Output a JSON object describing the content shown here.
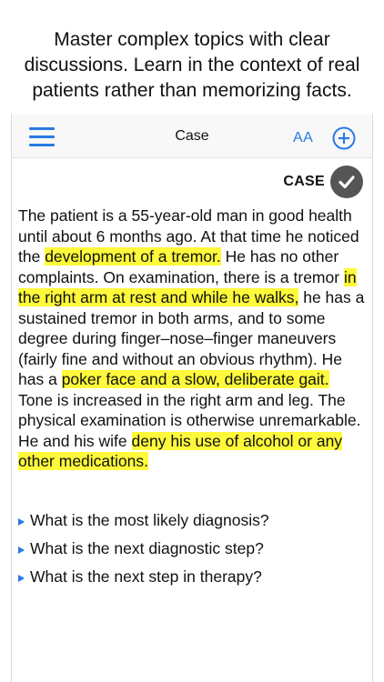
{
  "promo": {
    "line1": "Master complex topics with clear",
    "line2": "discussions. Learn in the context of real",
    "line3": "patients rather than memorizing facts."
  },
  "navbar": {
    "menu_icon": "hamburger-menu-icon",
    "title": "Case",
    "font_size_label": "AA",
    "add_icon": "plus-circle-icon",
    "accent_color": "#2a7ae2"
  },
  "case": {
    "label": "CASE",
    "check_icon": "checkmark-circle-icon",
    "highlight_color": "#fef93a",
    "text_segments": [
      {
        "text": "The patient is a 55-year-old man in good health until about 6 months ago. At that time he noticed the ",
        "highlighted": false
      },
      {
        "text": "development of a tremor.",
        "highlighted": true
      },
      {
        "text": " He has no other complaints. On examination, there is a tremor ",
        "highlighted": false
      },
      {
        "text": "in the right arm at rest and while he walks,",
        "highlighted": true
      },
      {
        "text": " he has a sustained tremor in both arms, and to some degree during finger–nose–finger maneuvers (fairly fine and without an obvious rhythm). He has a ",
        "highlighted": false
      },
      {
        "text": "poker face and a slow, deliberate gait.",
        "highlighted": true
      },
      {
        "text": " Tone is increased in the right arm and leg. The physical examination is otherwise unremarkable. He and his wife ",
        "highlighted": false
      },
      {
        "text": "deny his use of alcohol or any other medications.",
        "highlighted": true
      }
    ]
  },
  "questions": [
    {
      "label": "What is the most likely diagnosis?",
      "icon": "disclosure-triangle-icon"
    },
    {
      "label": "What is the next diagnostic step?",
      "icon": "disclosure-triangle-icon"
    },
    {
      "label": "What is the next step in therapy?",
      "icon": "disclosure-triangle-icon"
    }
  ]
}
